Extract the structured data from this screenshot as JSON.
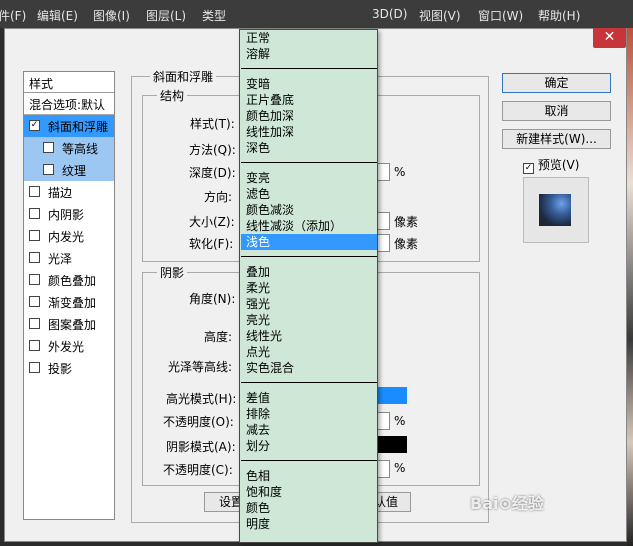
{
  "menubar": {
    "items": [
      "文件(F)",
      "编辑(E)",
      "图像(I)",
      "图层(L)",
      "类型(Y)",
      "3D(D)",
      "视图(V)",
      "窗口(W)",
      "帮助(H)"
    ],
    "visible": [
      "文件(F)",
      "编辑(E)",
      "图像(I)",
      "图层(L)",
      "类型",
      "3D(D)",
      "视图(V)",
      "窗口(W)",
      "帮助(H)"
    ]
  },
  "dialog": {
    "close_glyph": "✕",
    "style_list": {
      "header": "样式",
      "blend_default": "混合选项:默认",
      "items": [
        {
          "label": "斜面和浮雕",
          "checked": true,
          "selected": true
        },
        {
          "label": "等高线",
          "checked": false,
          "sub": true
        },
        {
          "label": "纹理",
          "checked": false,
          "sub": true
        },
        {
          "label": "描边",
          "checked": false
        },
        {
          "label": "内阴影",
          "checked": false
        },
        {
          "label": "内发光",
          "checked": false
        },
        {
          "label": "光泽",
          "checked": false
        },
        {
          "label": "颜色叠加",
          "checked": false
        },
        {
          "label": "渐变叠加",
          "checked": false
        },
        {
          "label": "图案叠加",
          "checked": false
        },
        {
          "label": "外发光",
          "checked": false
        },
        {
          "label": "投影",
          "checked": false
        }
      ]
    },
    "bevel": {
      "title": "斜面和浮雕",
      "structure_title": "结构",
      "style_label": "样式(T):",
      "method_label": "方法(Q):",
      "depth_label": "深度(D):",
      "depth_unit": "%",
      "direction_label": "方向:",
      "size_label": "大小(Z):",
      "size_unit": "像素",
      "soften_label": "软化(F):",
      "soften_unit": "像素"
    },
    "shading": {
      "title": "阴影",
      "angle_label": "角度(N):",
      "altitude_label": "高度:",
      "gloss_label": "光泽等高线:",
      "highlight_mode_label": "高光模式(H):",
      "highlight_opacity_label": "不透明度(O):",
      "highlight_opacity_unit": "%",
      "shadow_mode_label": "阴影模式(A):",
      "shadow_opacity_label": "不透明度(C):",
      "shadow_opacity_unit": "%",
      "highlight_color": "#1a8cff",
      "shadow_color": "#000000"
    },
    "bottom": {
      "set_default_partial": "设置",
      "reset_default_partial": "认值"
    },
    "buttons": {
      "ok": "确定",
      "cancel": "取消",
      "new_style": "新建样式(W)...",
      "preview_label": "预览(V)",
      "preview_checked": true
    }
  },
  "blend_mode_dropdown": {
    "selected": "浅色",
    "groups": [
      [
        "正常",
        "溶解"
      ],
      [
        "变暗",
        "正片叠底",
        "颜色加深",
        "线性加深",
        "深色"
      ],
      [
        "变亮",
        "滤色",
        "颜色减淡",
        "线性减淡（添加）",
        "浅色"
      ],
      [
        "叠加",
        "柔光",
        "强光",
        "亮光",
        "线性光",
        "点光",
        "实色混合"
      ],
      [
        "差值",
        "排除",
        "减去",
        "划分"
      ],
      [
        "色相",
        "饱和度",
        "颜色",
        "明度"
      ]
    ]
  },
  "watermark": "Bai⊙经验"
}
